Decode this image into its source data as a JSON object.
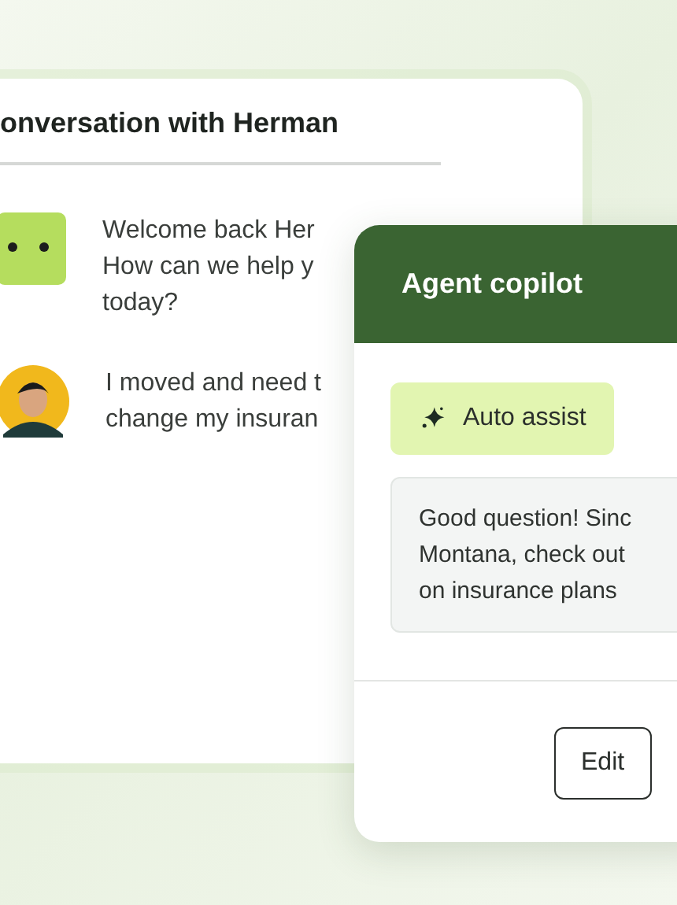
{
  "conversation": {
    "title": "onversation with Herman",
    "messages": [
      {
        "kind": "bot",
        "lines": [
          "Welcome back Her",
          "How can we help y",
          "today?"
        ]
      },
      {
        "kind": "customer",
        "lines": [
          "I moved and need t",
          "change my insuran"
        ]
      }
    ]
  },
  "copilot": {
    "title": "Agent copilot",
    "chip": "Auto assist",
    "suggestion": [
      "Good question! Sinc",
      "Montana, check out",
      "on insurance plans"
    ],
    "button": "Edit"
  }
}
